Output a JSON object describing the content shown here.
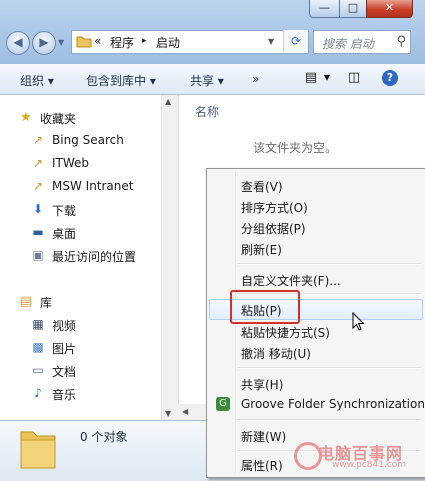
{
  "window_controls": {
    "minimize": "—",
    "maximize": "□",
    "close": "✕"
  },
  "address": {
    "chevron": "«",
    "segments": [
      "程序",
      "启动"
    ],
    "separator": "▸"
  },
  "search": {
    "placeholder": "搜索 启动"
  },
  "toolbar": {
    "organize": "组织 ▾",
    "include_library": "包含到库中 ▾",
    "share": "共享 ▾",
    "more": "»",
    "help": "?"
  },
  "nav": {
    "favorites": "收藏夹",
    "favorite_items": [
      "Bing Search",
      "ITWeb",
      "MSW Intranet",
      "下载",
      "桌面",
      "最近访问的位置"
    ],
    "library": "库",
    "library_items": [
      "视频",
      "图片",
      "文档",
      "音乐"
    ]
  },
  "content": {
    "column_name": "名称",
    "empty_text": "该文件夹为空。"
  },
  "details": {
    "count": "0 个对象"
  },
  "context_menu": {
    "group1": [
      "查看(V)",
      "排序方式(O)",
      "分组依据(P)",
      "刷新(E)"
    ],
    "group2": [
      "自定义文件夹(F)..."
    ],
    "group3": [
      "粘贴(P)",
      "粘贴快捷方式(S)",
      "撤消 移动(U)"
    ],
    "group4": [
      "共享(H)",
      "Groove Folder Synchronization"
    ],
    "group5": [
      "新建(W)"
    ],
    "group6": [
      "属性(R)"
    ],
    "highlighted": "粘贴(P)"
  },
  "watermark": {
    "title": "电脑百事网",
    "sub": "www.pc841.com"
  },
  "colors": {
    "accent": "#2c67c3",
    "highlight_box": "#d0312d",
    "watermark": "#e04a4a"
  }
}
